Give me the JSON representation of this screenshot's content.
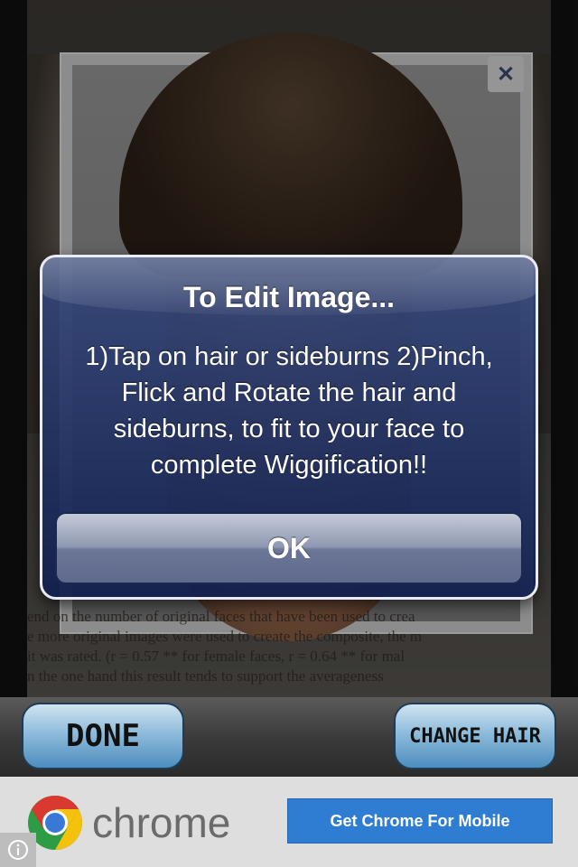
{
  "alert": {
    "title": "To Edit Image...",
    "message_lines": [
      "1)Tap on hair or sideburns 2)Pinch,",
      "Flick and Rotate the hair and",
      "sideburns, to fit to your face to",
      "complete Wiggification!!"
    ],
    "ok_label": "OK"
  },
  "photo": {
    "close_symbol": "✕",
    "document_lines": [
      "end on the number of original faces that have been used to crea",
      "e more original images were used to create the composite, the m",
      "it was rated.  (r = 0.57 ** for female faces, r = 0.64 ** for mal",
      "n the one hand this result tends to support the averageness"
    ]
  },
  "toolbar": {
    "done_label": "DONE",
    "change_hair_label": "CHANGE HAIR"
  },
  "ad": {
    "brand": "chrome",
    "cta_label": "Get Chrome For Mobile",
    "info_icon": "info-icon"
  },
  "colors": {
    "alert_blue": "#1c2d63",
    "toolbar_button_blue": "#8fbcdb",
    "ad_cta_blue": "#2f7cd3"
  }
}
